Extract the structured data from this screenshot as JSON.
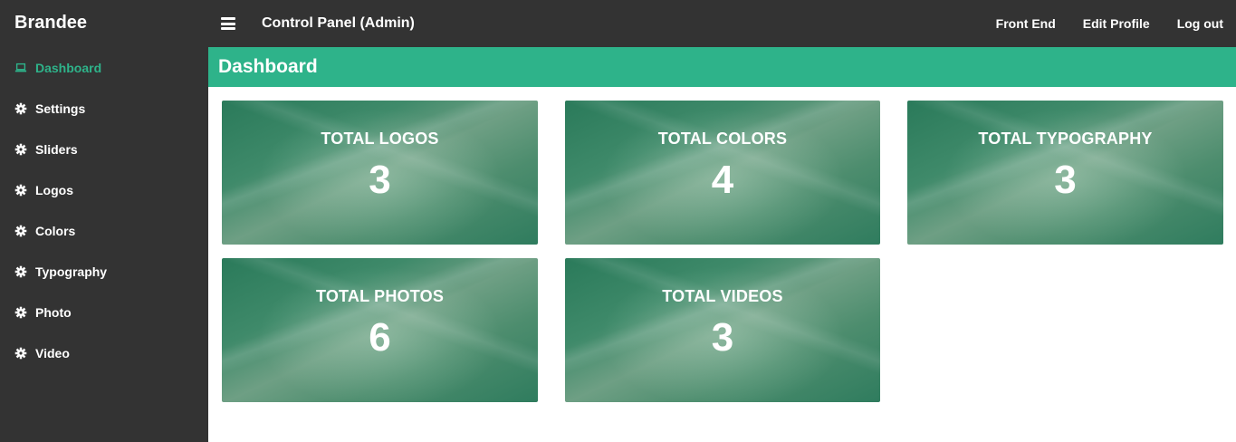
{
  "brand": "Brandee",
  "header": {
    "title": "Control Panel (Admin)",
    "links": [
      "Front End",
      "Edit Profile",
      "Log out"
    ]
  },
  "sidebar": {
    "items": [
      {
        "label": "Dashboard",
        "icon": "laptop-icon",
        "active": true
      },
      {
        "label": "Settings",
        "icon": "gear-icon"
      },
      {
        "label": "Sliders",
        "icon": "gear-icon"
      },
      {
        "label": "Logos",
        "icon": "gear-icon"
      },
      {
        "label": "Colors",
        "icon": "gear-icon"
      },
      {
        "label": "Typography",
        "icon": "gear-icon"
      },
      {
        "label": "Photo",
        "icon": "gear-icon"
      },
      {
        "label": "Video",
        "icon": "gear-icon"
      }
    ]
  },
  "page": {
    "heading": "Dashboard"
  },
  "cards": [
    {
      "title": "TOTAL LOGOS",
      "value": "3"
    },
    {
      "title": "TOTAL COLORS",
      "value": "4"
    },
    {
      "title": "TOTAL TYPOGRAPHY",
      "value": "3"
    },
    {
      "title": "TOTAL PHOTOS",
      "value": "6"
    },
    {
      "title": "TOTAL VIDEOS",
      "value": "3"
    }
  ],
  "colors": {
    "accent": "#2eb38a",
    "sidebar_bg": "#333333",
    "card_green": "#2e7f5f"
  }
}
